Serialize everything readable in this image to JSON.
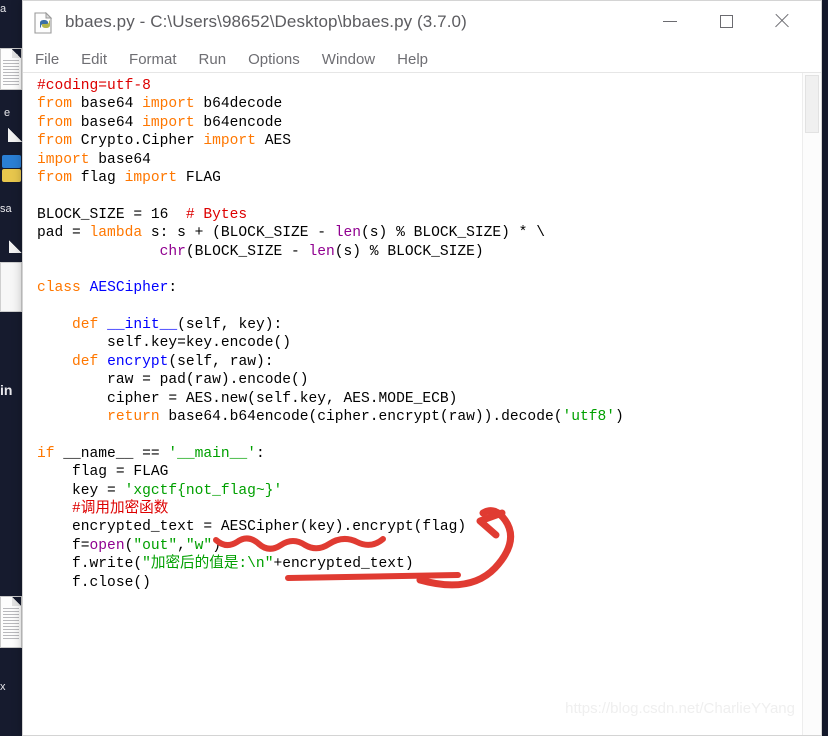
{
  "window": {
    "title": "bbaes.py - C:\\Users\\98652\\Desktop\\bbaes.py (3.7.0)",
    "app_icon": "python-file-icon",
    "controls": {
      "minimize": "minimize-icon",
      "maximize": "maximize-icon",
      "close": "close-icon"
    }
  },
  "menu": {
    "items": [
      {
        "label": "File"
      },
      {
        "label": "Edit"
      },
      {
        "label": "Format"
      },
      {
        "label": "Run"
      },
      {
        "label": "Options"
      },
      {
        "label": "Window"
      },
      {
        "label": "Help"
      }
    ]
  },
  "editor": {
    "lines": [
      [
        {
          "t": "#coding=utf-8",
          "c": "cm"
        }
      ],
      [
        {
          "t": "from",
          "c": "kw"
        },
        {
          "t": " base64 ",
          "c": "pl"
        },
        {
          "t": "import",
          "c": "kw"
        },
        {
          "t": " b64decode",
          "c": "pl"
        }
      ],
      [
        {
          "t": "from",
          "c": "kw"
        },
        {
          "t": " base64 ",
          "c": "pl"
        },
        {
          "t": "import",
          "c": "kw"
        },
        {
          "t": " b64encode",
          "c": "pl"
        }
      ],
      [
        {
          "t": "from",
          "c": "kw"
        },
        {
          "t": " Crypto.Cipher ",
          "c": "pl"
        },
        {
          "t": "import",
          "c": "kw"
        },
        {
          "t": " AES",
          "c": "pl"
        }
      ],
      [
        {
          "t": "import",
          "c": "kw"
        },
        {
          "t": " base64",
          "c": "pl"
        }
      ],
      [
        {
          "t": "from",
          "c": "kw"
        },
        {
          "t": " flag ",
          "c": "pl"
        },
        {
          "t": "import",
          "c": "kw"
        },
        {
          "t": " FLAG",
          "c": "pl"
        }
      ],
      [
        {
          "t": "",
          "c": "pl"
        }
      ],
      [
        {
          "t": "BLOCK_SIZE = 16  ",
          "c": "pl"
        },
        {
          "t": "# Bytes",
          "c": "cm"
        }
      ],
      [
        {
          "t": "pad = ",
          "c": "pl"
        },
        {
          "t": "lambda",
          "c": "kw"
        },
        {
          "t": " s: s + (BLOCK_SIZE - ",
          "c": "pl"
        },
        {
          "t": "len",
          "c": "bi"
        },
        {
          "t": "(s) % BLOCK_SIZE) * \\",
          "c": "pl"
        }
      ],
      [
        {
          "t": "              ",
          "c": "pl"
        },
        {
          "t": "chr",
          "c": "bi"
        },
        {
          "t": "(BLOCK_SIZE - ",
          "c": "pl"
        },
        {
          "t": "len",
          "c": "bi"
        },
        {
          "t": "(s) % BLOCK_SIZE)",
          "c": "pl"
        }
      ],
      [
        {
          "t": "",
          "c": "pl"
        }
      ],
      [
        {
          "t": "class",
          "c": "kw"
        },
        {
          "t": " ",
          "c": "pl"
        },
        {
          "t": "AESCipher",
          "c": "df"
        },
        {
          "t": ":",
          "c": "pl"
        }
      ],
      [
        {
          "t": "",
          "c": "pl"
        }
      ],
      [
        {
          "t": "    ",
          "c": "pl"
        },
        {
          "t": "def",
          "c": "kw"
        },
        {
          "t": " ",
          "c": "pl"
        },
        {
          "t": "__init__",
          "c": "df"
        },
        {
          "t": "(self, key):",
          "c": "pl"
        }
      ],
      [
        {
          "t": "        self.key=key.encode()",
          "c": "pl"
        }
      ],
      [
        {
          "t": "    ",
          "c": "pl"
        },
        {
          "t": "def",
          "c": "kw"
        },
        {
          "t": " ",
          "c": "pl"
        },
        {
          "t": "encrypt",
          "c": "df"
        },
        {
          "t": "(self, raw):",
          "c": "pl"
        }
      ],
      [
        {
          "t": "        raw = pad(raw).encode()",
          "c": "pl"
        }
      ],
      [
        {
          "t": "        cipher = AES.new(self.key, AES.MODE_ECB)",
          "c": "pl"
        }
      ],
      [
        {
          "t": "        ",
          "c": "pl"
        },
        {
          "t": "return",
          "c": "kw"
        },
        {
          "t": " base64.b64encode(cipher.encrypt(raw)).decode(",
          "c": "pl"
        },
        {
          "t": "'utf8'",
          "c": "st"
        },
        {
          "t": ")",
          "c": "pl"
        }
      ],
      [
        {
          "t": "",
          "c": "pl"
        }
      ],
      [
        {
          "t": "if",
          "c": "kw"
        },
        {
          "t": " __name__ == ",
          "c": "pl"
        },
        {
          "t": "'__main__'",
          "c": "st"
        },
        {
          "t": ":",
          "c": "pl"
        }
      ],
      [
        {
          "t": "    flag = FLAG",
          "c": "pl"
        }
      ],
      [
        {
          "t": "    key = ",
          "c": "pl"
        },
        {
          "t": "'xgctf{not_flag~}'",
          "c": "st"
        }
      ],
      [
        {
          "t": "    #调用加密函数",
          "c": "cm"
        }
      ],
      [
        {
          "t": "    encrypted_text = AESCipher(key).encrypt(flag)",
          "c": "pl"
        }
      ],
      [
        {
          "t": "    f=",
          "c": "pl"
        },
        {
          "t": "open",
          "c": "bi"
        },
        {
          "t": "(",
          "c": "pl"
        },
        {
          "t": "\"out\"",
          "c": "st"
        },
        {
          "t": ",",
          "c": "pl"
        },
        {
          "t": "\"w\"",
          "c": "st"
        },
        {
          "t": ")",
          "c": "pl"
        }
      ],
      [
        {
          "t": "    f.write(",
          "c": "pl"
        },
        {
          "t": "\"加密后的值是:\\n\"",
          "c": "st"
        },
        {
          "t": "+encrypted_text)",
          "c": "pl"
        }
      ],
      [
        {
          "t": "    f.close()",
          "c": "pl"
        }
      ]
    ]
  },
  "annotations": {
    "color": "#e03b32",
    "marks": [
      {
        "name": "squiggly-underline-open-line",
        "type": "squiggle"
      },
      {
        "name": "straight-underline-write-line",
        "type": "line"
      },
      {
        "name": "curved-arrow-to-encrypt",
        "type": "arrow"
      }
    ]
  },
  "watermark": {
    "text": "https://blog.csdn.net/CharlieYYang"
  },
  "desktop_strip": {
    "fragments": [
      {
        "label": "a"
      },
      {
        "label": "e"
      },
      {
        "label": "sa"
      },
      {
        "label": "in"
      },
      {
        "label": "x"
      }
    ]
  },
  "colors": {
    "comment": "#dd0000",
    "keyword": "#ff7700",
    "string": "#00a000",
    "builtin": "#900090",
    "definition": "#0000ff",
    "annotation": "#e03b32",
    "desktop": "#161b2e"
  }
}
